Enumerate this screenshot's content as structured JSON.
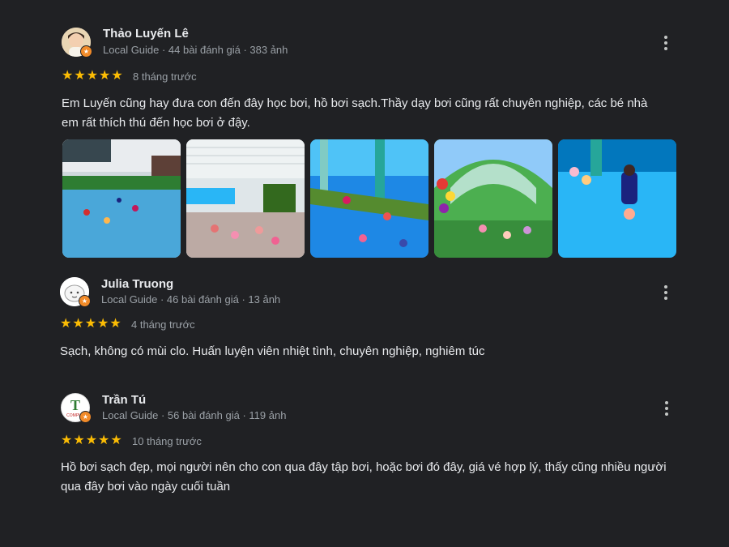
{
  "reviews": [
    {
      "name": "Thảo Luyến Lê",
      "meta": "Local Guide · 44 bài đánh giá · 383 ảnh",
      "rating": 5,
      "time": "8 tháng trước",
      "text": "Em Luyến cũng hay đưa con đến đây học bơi, hồ bơi sạch.Thầy dạy bơi cũng rất chuyên nghiệp, các bé nhà em rất thích thú đến học bơi ở đậy.",
      "photos": [
        "indoor-pool-kids-swimming",
        "poolside-children-sitting",
        "kids-in-pool-with-slide",
        "covered-walkway-children",
        "instructor-in-pool"
      ]
    },
    {
      "name": "Julia Truong",
      "meta": "Local Guide · 46 bài đánh giá · 13 ảnh",
      "rating": 5,
      "time": "4 tháng trước",
      "text": "Sạch, không có mùi clo. Huấn luyện viên nhiệt tình, chuyên nghiệp, nghiêm túc"
    },
    {
      "name": "Trần Tú",
      "meta": "Local Guide · 56 bài đánh giá · 119 ảnh",
      "rating": 5,
      "time": "10 tháng trước",
      "text": "Hồ bơi sạch đẹp, mọi người nên cho con qua đây tập bơi, hoặc bơi đó đây, giá vé hợp lý, thấy cũng nhiều người qua đây bơi vào ngày cuối tuần",
      "avatar_text": "T",
      "avatar_subtext": "COMPUT"
    }
  ],
  "colors": {
    "background": "#202124",
    "star": "#fbbc04",
    "local_guide_badge": "#f28b29",
    "text_primary": "#e8eaed",
    "text_secondary": "#9aa0a6"
  },
  "icons": {
    "more": "more-vert-icon",
    "star": "star-icon",
    "badge": "local-guide-badge-icon"
  }
}
